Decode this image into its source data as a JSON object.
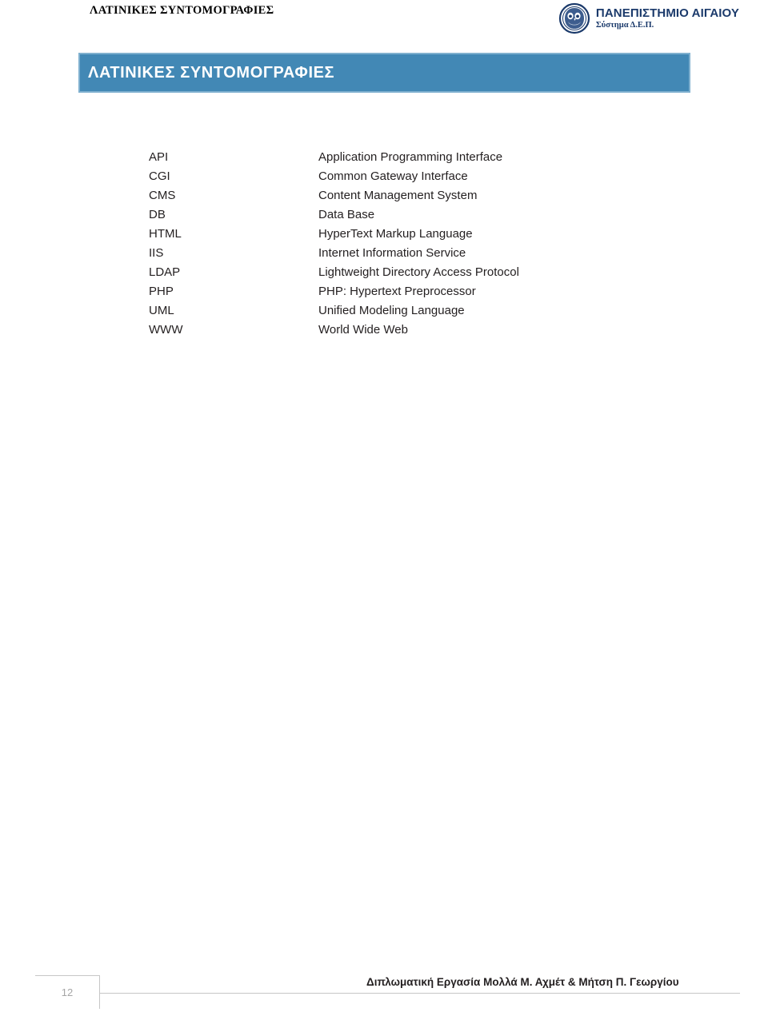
{
  "document": {
    "running_header": "ΛΑΤΙΝΙΚΕΣ ΣΥΝΤΟΜΟΓΡΑΦΙΕΣ",
    "page_number": "12"
  },
  "logo": {
    "emblem_name": "aegean-owl-emblem",
    "line1": "ΠΑΝΕΠΙΣΤΗΜΙΟ ΑΙΓΑΙΟΥ",
    "line2": "Σύστημα Δ.Ε.Π.",
    "color": "#1b3a6b"
  },
  "banner": {
    "title": "ΛΑΤΙΝΙΚΕΣ ΣΥΝΤΟΜΟΓΡΑΦΙΕΣ",
    "fill_color": "#4288b5",
    "border_color": "#7fb0cf",
    "text_color": "#ffffff"
  },
  "abbreviations": [
    {
      "term": "API",
      "definition": "Application Programming Interface"
    },
    {
      "term": "CGI",
      "definition": "Common Gateway Interface"
    },
    {
      "term": "CMS",
      "definition": "Content Management System"
    },
    {
      "term": "DB",
      "definition": "Data Base"
    },
    {
      "term": "HTML",
      "definition": "HyperText Markup Language"
    },
    {
      "term": "IIS",
      "definition": "Internet Information Service"
    },
    {
      "term": "LDAP",
      "definition": "Lightweight Directory Access Protocol"
    },
    {
      "term": "PHP",
      "definition": "PHP: Hypertext Preprocessor"
    },
    {
      "term": "UML",
      "definition": "Unified Modeling Language"
    },
    {
      "term": "WWW",
      "definition": "World Wide Web"
    }
  ],
  "footer": {
    "caption": "Διπλωματική Εργασία Μολλά Μ. Αχμέτ & Μήτση Π. Γεωργίου",
    "rule_color": "#c6c6c6",
    "page_number_color": "#a6a6a6"
  }
}
